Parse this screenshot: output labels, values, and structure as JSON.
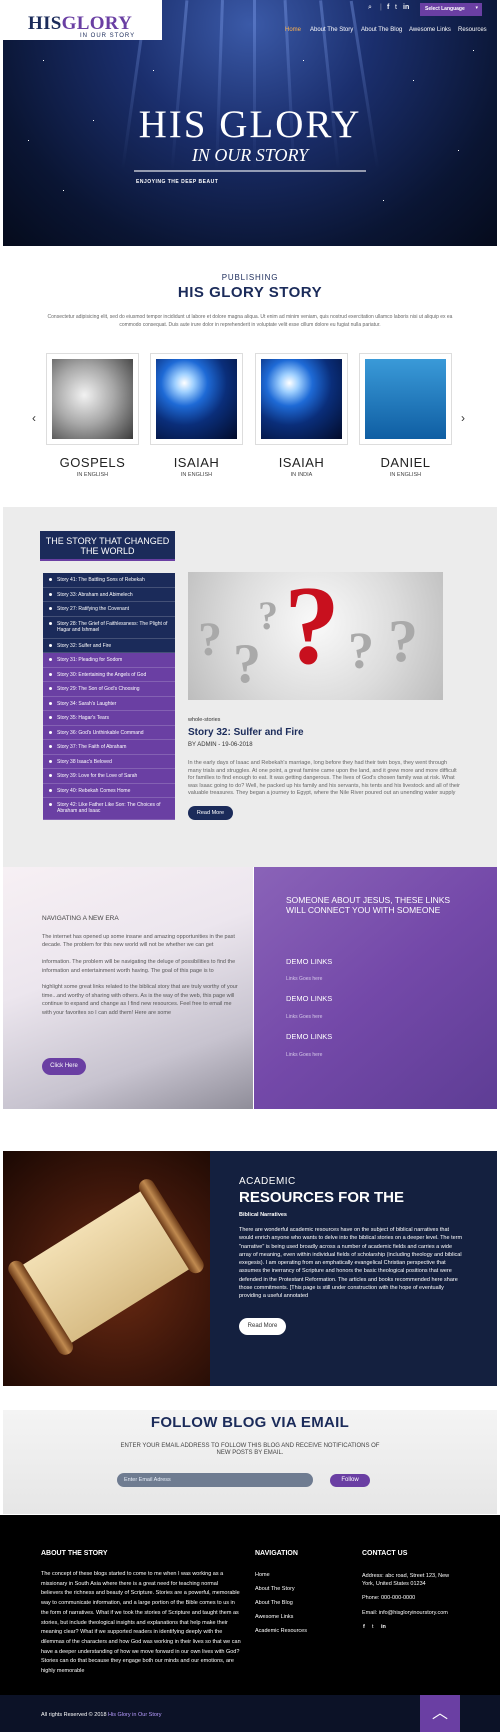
{
  "header": {
    "logo_his": "HIS",
    "logo_glory": "GLORY",
    "logo_sub": "IN OUR STORY",
    "language_label": "Select Language",
    "language_icon": "chevron-down-icon",
    "social_icons": [
      "search-icon",
      "facebook-icon",
      "twitter-icon",
      "linkedin-icon"
    ],
    "nav": [
      "Home",
      "About The Story",
      "About The Blog",
      "Awesome Links",
      "Resources"
    ]
  },
  "hero": {
    "title": "HIS GLORY",
    "subtitle": "IN OUR STORY",
    "tagline": "ENJOYING THE DEEP BEAUT"
  },
  "publishing": {
    "label": "PUBLISHING",
    "title": "HIS GLORY STORY",
    "text": "Consectetur adipisicing elit, sed do eiusmod tempor incididunt ut labore et dolore magna aliqua. Ut enim ad minim veniam, quis nostrud exercitation ullamco laboris nisi ut aliquip ex ea commodo consequat. Duis aute irure dolor in reprehenderit in voluptate velit esse cillum dolore eu fugiat nulla pariatur.",
    "prev_icon": "chevron-left-icon",
    "next_icon": "chevron-right-icon",
    "cards": [
      {
        "title": "GOSPELS",
        "sub": "IN ENGLISH"
      },
      {
        "title": "ISAIAH",
        "sub": "IN ENGLISH"
      },
      {
        "title": "ISAIAH",
        "sub": "IN INDIA"
      },
      {
        "title": "DANIEL",
        "sub": "IN ENGLISH"
      }
    ]
  },
  "stories": {
    "heading": "THE STORY THAT CHANGED THE WORLD",
    "list": [
      "Story 41: The Battling Sons of Rebekah",
      "Story 33: Abraham and Abimelech",
      "Story 27: Ratifying the Covenant",
      "Story 28: The Grief of Faithlessness: The Plight of Hagar and Ishmael",
      "Story 32: Sulfer and Fire",
      "Story 31: Pleading for Sodom",
      "Story 30: Entertaining the Angels of God",
      "Story 29: The Son of God's Choosing",
      "Story 34: Sarah's Laughter",
      "Story 35: Hagar's Tears",
      "Story 36: God's Unthinkable Command",
      "Story 37: The Faith of Abraham",
      "Story 38 Isaac's Beloved",
      "Story 39: Love for the Love of Sarah",
      "Story 40: Rebekah Comes Home",
      "Story 42: Like Father Like Son: The Choices of Abraham and Isaac"
    ],
    "category": "whole-stories",
    "title": "Story 32: Sulfer and Fire",
    "meta": "BY ADMIN - 19-06-2018",
    "text": "In the early days of Isaac and Rebekah's marriage, long before they had their twin boys, they went through many trials and struggles. At one point, a great famine came upon the land, and it grew more and more difficult for families to find enough to eat. It was getting dangerous. The lives of God's chosen family was at risk. What was Isaac going to do? Well, he packed up his family and his servants, his tents and his livestock and all of their valuable treasures. They began a journey to Egypt, where the Nile River poured out an unending water supply",
    "button": "Read More"
  },
  "navigating": {
    "label": "NAVIGATING A NEW ERA",
    "text": "The internet has opened up some insane and amazing opportunities in the past decade. The problem for this new world will not be whether we can get\n\ninformation. The problem will be navigating the deluge of possibilities to find the information and entertainment worth having. The goal of this page is to\n\nhighlight some great links related to the biblical story that are truly worthy of your time...and worthy of sharing with others. As is the way of the web, this page will continue to expand and change as I find new resources. Feel free to email me with your favorites so I can add them! Here are some",
    "button": "Click Here"
  },
  "links": {
    "heading": "SOMEONE ABOUT JESUS, THESE LINKS WILL CONNECT YOU WITH SOMEONE",
    "items": [
      {
        "title": "DEMO LINKS",
        "sub": "Links Goes here"
      },
      {
        "title": "DEMO LINKS",
        "sub": "Links Goes here"
      },
      {
        "title": "DEMO LINKS",
        "sub": "Links Goes here"
      }
    ]
  },
  "academic": {
    "label": "ACADEMIC",
    "title": "RESOURCES FOR THE",
    "sub": "Biblical Narratives",
    "text": "There are wonderful academic resources have on the subject of biblical narratives that would enrich anyone who wants to delve into the biblical stories on a deeper level. The term \"narrative\" is being used broadly across a number of academic fields and carries a wide array of meaning, even within individual fields of scholarship (including theology and biblical exegesis). I am operating from an emphatically evangelical Christian perspective that assumes the inerrancy of Scripture and honors the basic theological positions that were defended in the Protestant Reformation. The articles and books recommended here share those commitments. [This page is still under construction with the hope of eventually providing a useful annotated",
    "button": "Read More"
  },
  "follow": {
    "title": "FOLLOW BLOG VIA EMAIL",
    "text": "ENTER YOUR EMAIL ADDRESS TO FOLLOW THIS BLOG AND RECEIVE NOTIFICATIONS OF NEW POSTS BY EMAIL.",
    "placeholder": "Enter Email Adress",
    "button": "Follow"
  },
  "footer": {
    "about_head": "ABOUT THE STORY",
    "about_text": "The concept of these blogs started to come to me when I was working as a missionary in South Asia where there is a great need for teaching normal believers the richness and beauty of Scripture. Stories are a powerful, memorable way to communicate information, and a large portion of the Bible comes to us in the form of narratives. What if we took the stories of Scripture and taught them as stories, but include theological insights and explanations that help make their meaning clear? What if we supported readers in identifying deeply with the dilemmas of the characters and how God was working in their lives so that we can have a deeper understanding of how we move forward in our own lives with God? Stories can do that because they engage both our minds and our emotions, are highly memorable",
    "nav_head": "NAVIGATION",
    "nav_links": [
      "Home",
      "About The Story",
      "About The Blog",
      "Awesome Links",
      "Academic Resources"
    ],
    "contact_head": "CONTACT US",
    "address": "Address: abc road, Street 123, New York, United States 01234",
    "phone": "Phone: 000-000-0000",
    "email": "Email: info@hisgloryinourstory.com",
    "copyright_prefix": "All rights Reserved © 2018 ",
    "copyright_link": "His Glory in Our Story",
    "top_icon": "chevron-up-icon"
  }
}
